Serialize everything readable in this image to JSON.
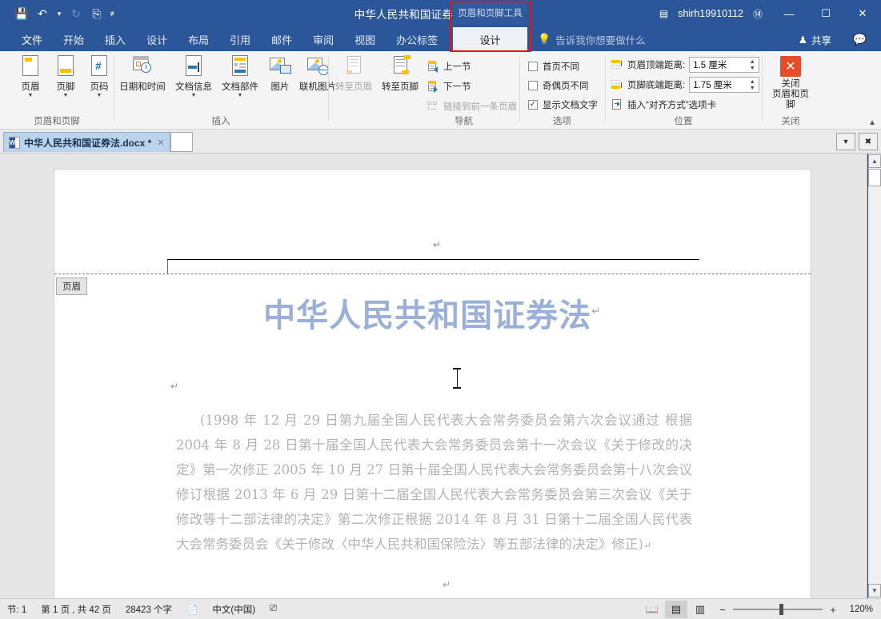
{
  "titlebar": {
    "document_title": "中华人民共和国证券法.docx  -  Word",
    "contextual_tools_label": "页眉和页脚工具",
    "account_name": "shirh19910112",
    "quick_access": [
      {
        "name": "save-icon",
        "glyph": "💾"
      },
      {
        "name": "undo-icon",
        "glyph": "↶"
      },
      {
        "name": "undo-dropdown-icon",
        "glyph": "▾"
      },
      {
        "name": "redo-icon",
        "glyph": "↻"
      },
      {
        "name": "quick-print-icon",
        "glyph": "⎘"
      },
      {
        "name": "customize-qat-icon",
        "glyph": "≡"
      }
    ],
    "ribbon_display_options_icon": "▤",
    "restore_down_icon": "❐",
    "minimize_label": "—",
    "maximize_label": "☐",
    "close_label": "✕"
  },
  "tabs": [
    {
      "label": "文件",
      "name": "tab-file"
    },
    {
      "label": "开始",
      "name": "tab-home"
    },
    {
      "label": "插入",
      "name": "tab-insert"
    },
    {
      "label": "设计",
      "name": "tab-design"
    },
    {
      "label": "布局",
      "name": "tab-layout"
    },
    {
      "label": "引用",
      "name": "tab-references"
    },
    {
      "label": "邮件",
      "name": "tab-mailings"
    },
    {
      "label": "审阅",
      "name": "tab-review"
    },
    {
      "label": "视图",
      "name": "tab-view"
    },
    {
      "label": "办公标签",
      "name": "tab-office-labels"
    }
  ],
  "contextual_tab": {
    "label": "设计",
    "active": true
  },
  "tell_me": {
    "placeholder": "告诉我你想要做什么",
    "icon": "lightbulb-icon"
  },
  "share": {
    "label": "共享",
    "icon": "person-add-icon"
  },
  "comments": {
    "icon": "comment-icon"
  },
  "highlight": {
    "color": "#ee1111",
    "target": "页眉和页脚工具 设计"
  },
  "ribbon": {
    "groups": [
      {
        "name": "header-footer-group",
        "label": "页眉和页脚",
        "buttons": [
          {
            "label": "页眉",
            "name": "header-button",
            "has_caret": true
          },
          {
            "label": "页脚",
            "name": "footer-button",
            "has_caret": true
          },
          {
            "label": "页码",
            "name": "page-number-button",
            "has_caret": true
          }
        ]
      },
      {
        "name": "insert-group",
        "label": "插入",
        "buttons": [
          {
            "label": "日期和时间",
            "name": "date-time-button",
            "has_caret": false
          },
          {
            "label": "文档信息",
            "name": "document-info-button",
            "has_caret": true
          },
          {
            "label": "文档部件",
            "name": "quick-parts-button",
            "has_caret": true
          },
          {
            "label": "图片",
            "name": "pictures-button",
            "has_caret": false
          },
          {
            "label": "联机图片",
            "name": "online-pictures-button",
            "has_caret": false
          }
        ]
      },
      {
        "name": "navigation-group",
        "label": "导航",
        "big_buttons": [
          {
            "label": "转至页眉",
            "name": "go-to-header-button",
            "disabled": true
          },
          {
            "label": "转至页脚",
            "name": "go-to-footer-button",
            "disabled": false
          }
        ],
        "small_buttons": [
          {
            "label": "上一节",
            "name": "previous-section-button",
            "disabled": false
          },
          {
            "label": "下一节",
            "name": "next-section-button",
            "disabled": false
          },
          {
            "label": "链接到前一条页眉",
            "name": "link-to-previous-button",
            "disabled": true
          }
        ]
      },
      {
        "name": "options-group",
        "label": "选项",
        "checkboxes": [
          {
            "label": "首页不同",
            "name": "different-first-page-checkbox",
            "checked": false
          },
          {
            "label": "奇偶页不同",
            "name": "different-odd-even-checkbox",
            "checked": false
          },
          {
            "label": "显示文档文字",
            "name": "show-document-text-checkbox",
            "checked": true
          }
        ]
      },
      {
        "name": "position-group",
        "label": "位置",
        "rows": [
          {
            "label": "页眉顶端距离:",
            "value": "1.5 厘米",
            "name": "header-from-top-spinner"
          },
          {
            "label": "页脚底端距离:",
            "value": "1.75 厘米",
            "name": "footer-from-bottom-spinner"
          }
        ],
        "insert_alignment_tab": {
          "label": "插入“对齐方式”选项卡",
          "name": "insert-alignment-tab-button"
        }
      },
      {
        "name": "close-group",
        "label": "关闭",
        "close_button": {
          "line1": "关闭",
          "line2": "页眉和页脚",
          "name": "close-header-footer-button",
          "color": "#e74c27"
        }
      }
    ],
    "collapse_icon": "⌃"
  },
  "doc_tabbar": {
    "tab": {
      "label": "中华人民共和国证券法.docx *",
      "name": "doc-tab-securities-law",
      "close_icon": "✕"
    },
    "dropdown_icon": "▾",
    "close_icon": "✖"
  },
  "document": {
    "header_label_tag": "页眉",
    "title": "中华人民共和国证券法",
    "pilcrow": "↵",
    "body_paragraph": "(1998 年 12 月 29 日第九届全国人民代表大会常务委员会第六次会议通过 根据 2004 年 8 月 28 日第十届全国人民代表大会常务委员会第十一次会议《关于修改的决定》第一次修正 2005 年 10 月 27 日第十届全国人民代表大会常务委员会第十八次会议修订根据 2013 年 6 月 29 日第十二届全国人民代表大会常务委员会第三次会议《关于修改等十二部法律的决定》第二次修正根据 2014 年 8 月 31 日第十二届全国人民代表大会常务委员会《关于修改〈中华人民共和国保险法〉等五部法律的决定》修正)",
    "title_color": "#9ab0d8",
    "body_color": "#b3b3b3"
  },
  "statusbar": {
    "section": "节: 1",
    "page": "第 1 页 , 共 42 页",
    "words": "28423 个字",
    "proofing_icon": "spellcheck-icon",
    "language": "中文(中国)",
    "macro_icon": "macro-record-icon",
    "view_buttons": [
      {
        "name": "read-mode-button",
        "glyph": "📖",
        "active": false
      },
      {
        "name": "print-layout-button",
        "glyph": "▤",
        "active": true
      },
      {
        "name": "web-layout-button",
        "glyph": "▥",
        "active": false
      }
    ],
    "zoom": {
      "minus": "−",
      "plus": "+",
      "level": "120%",
      "value": 120
    }
  },
  "scrollbar": {
    "up_arrow": "▲",
    "down_arrow": "▼"
  }
}
